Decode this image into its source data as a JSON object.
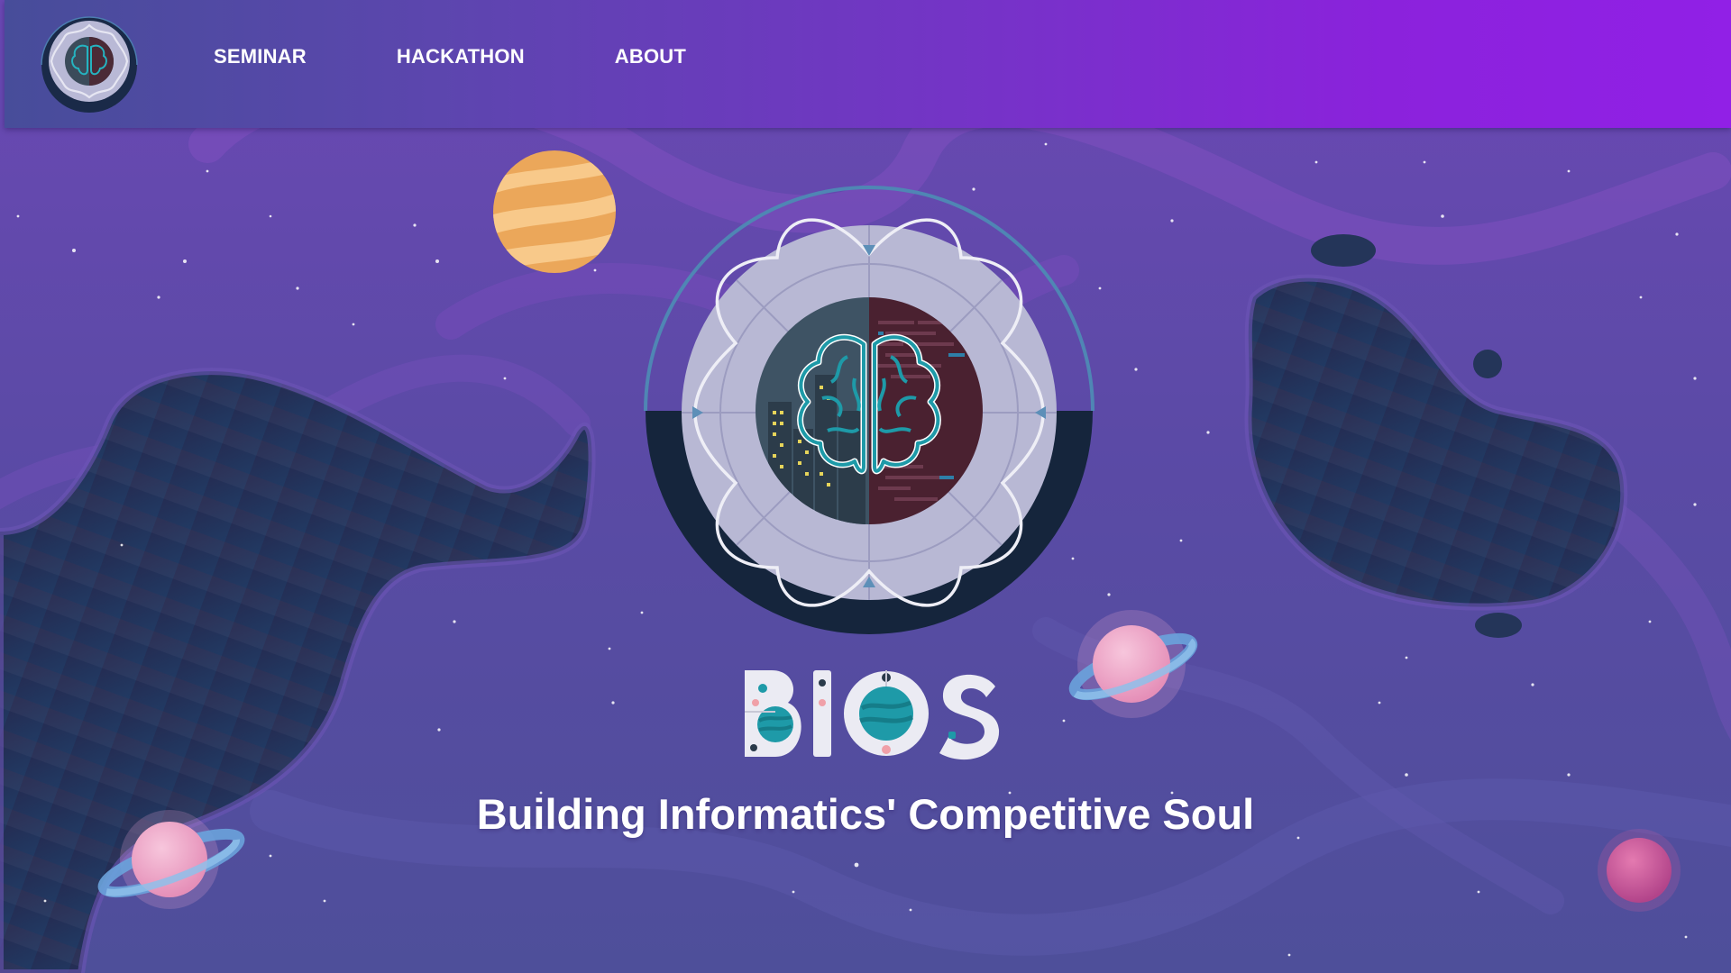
{
  "nav": {
    "logo_icon": "bios-brain-logo",
    "links": [
      {
        "label": "SEMINAR"
      },
      {
        "label": "HACKATHON"
      },
      {
        "label": "ABOUT"
      }
    ]
  },
  "hero": {
    "emblem_icon": "brain-circuit-emblem",
    "wordmark": "BIOS",
    "tagline": "Building Informatics' Competitive Soul"
  },
  "colors": {
    "navbar_start": "#474d9a",
    "navbar_end": "#9120e6",
    "background": "#5b4aa6",
    "accent_teal": "#1e9aa8",
    "planet_orange": "#f0b060",
    "planet_pink": "#f0a8c8",
    "dark_blob": "#233254"
  }
}
